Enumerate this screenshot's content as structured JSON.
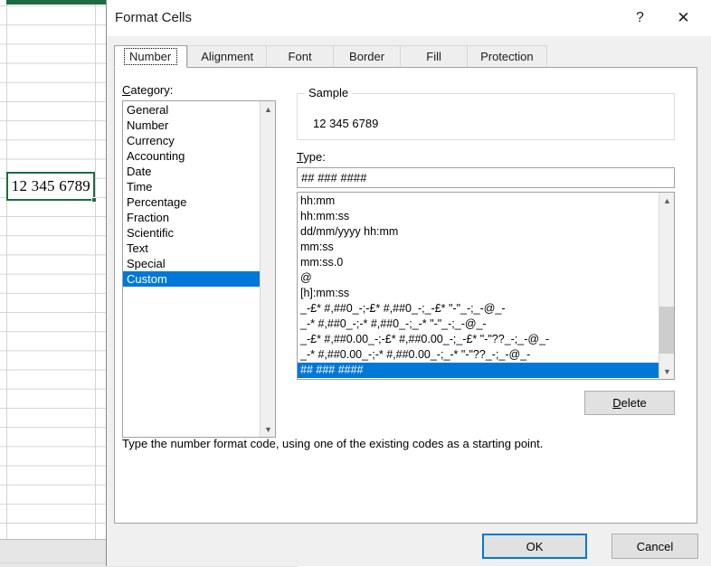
{
  "spreadsheet": {
    "selected_cell_value": "12 345 6789"
  },
  "dialog": {
    "title": "Format Cells",
    "help_icon": "?",
    "close_icon": "✕",
    "tabs": [
      {
        "label": "Number",
        "active": true
      },
      {
        "label": "Alignment",
        "active": false
      },
      {
        "label": "Font",
        "active": false
      },
      {
        "label": "Border",
        "active": false
      },
      {
        "label": "Fill",
        "active": false
      },
      {
        "label": "Protection",
        "active": false
      }
    ],
    "category": {
      "label_accel": "C",
      "label_rest": "ategory:",
      "items": [
        "General",
        "Number",
        "Currency",
        "Accounting",
        "Date",
        "Time",
        "Percentage",
        "Fraction",
        "Scientific",
        "Text",
        "Special",
        "Custom"
      ],
      "selected": "Custom"
    },
    "sample": {
      "legend": "Sample",
      "value": "12 345 6789"
    },
    "type": {
      "label_accel": "T",
      "label_rest": "ype:",
      "value": "## ### ####",
      "items": [
        "hh:mm",
        "hh:mm:ss",
        "dd/mm/yyyy hh:mm",
        "mm:ss",
        "mm:ss.0",
        "@",
        "[h]:mm:ss",
        "_-£* #,##0_-;-£* #,##0_-;_-£* \"-\"_-;_-@_-",
        "_-* #,##0_-;-* #,##0_-;_-* \"-\"_-;_-@_-",
        "_-£* #,##0.00_-;-£* #,##0.00_-;_-£* \"-\"??_-;_-@_-",
        "_-* #,##0.00_-;-* #,##0.00_-;_-* \"-\"??_-;_-@_-",
        "## ### ####"
      ],
      "selected": "## ### ####"
    },
    "delete_button": {
      "accel": "D",
      "rest": "elete"
    },
    "hint": "Type the number format code, using one of the existing codes as a starting point.",
    "ok_label": "OK",
    "cancel_label": "Cancel"
  },
  "colors": {
    "selection_blue": "#0078d7",
    "excel_green": "#1d6b43",
    "button_face": "#e1e1e1"
  }
}
